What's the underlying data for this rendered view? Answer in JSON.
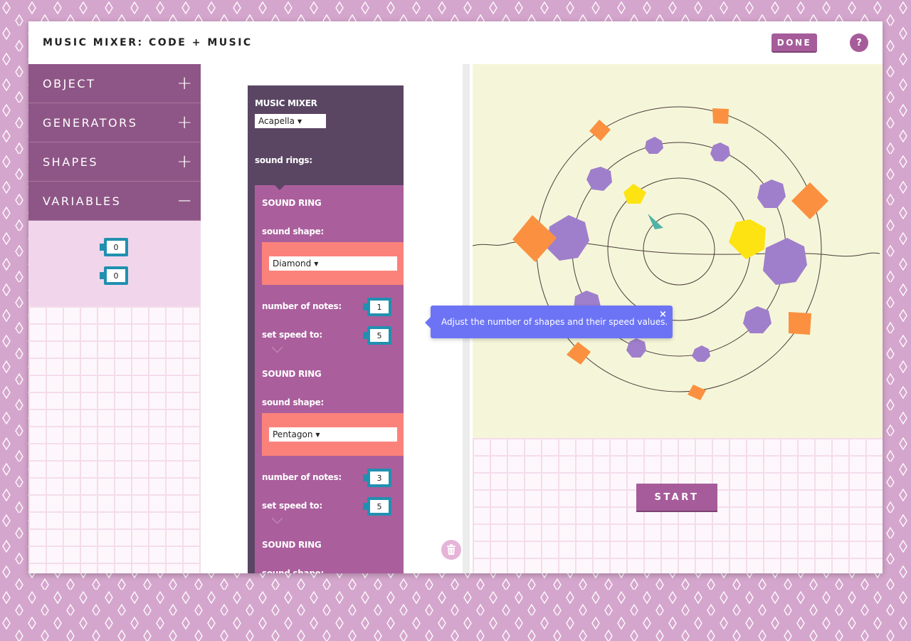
{
  "header": {
    "title": "MUSIC MIXER: CODE + MUSIC",
    "done_label": "DONE",
    "help_label": "?"
  },
  "sidebar": {
    "categories": [
      {
        "label": "OBJECT",
        "toggle": "+"
      },
      {
        "label": "GENERATORS",
        "toggle": "+"
      },
      {
        "label": "SHAPES",
        "toggle": "+"
      },
      {
        "label": "VARIABLES",
        "toggle": "−"
      }
    ],
    "variables": [
      "0",
      "0"
    ]
  },
  "workspace": {
    "block_title": "MUSIC MIXER",
    "sound_set": "Acapella",
    "rings_label": "sound rings:",
    "ring_title": "SOUND RING",
    "shape_label": "sound shape:",
    "notes_label": "number of notes:",
    "speed_label": "set speed to:",
    "rings": [
      {
        "shape": "Diamond",
        "notes": "1",
        "speed": "5"
      },
      {
        "shape": "Pentagon",
        "notes": "3",
        "speed": "5"
      },
      {
        "shape": "",
        "notes": "",
        "speed": ""
      }
    ]
  },
  "tooltip": {
    "text": "Adjust the number of shapes and their speed values.",
    "close": "×"
  },
  "stage": {
    "start_label": "START"
  },
  "colors": {
    "purple_dark": "#5a4663",
    "purple_block": "#aa5e9c",
    "salmon_block": "#fb827b",
    "teal": "#2190b0",
    "button": "#a65c9a",
    "tooltip": "#6c74f5",
    "stage_bg": "#f5f6d9",
    "shape_purple": "#9f7fcb",
    "shape_orange": "#fb9140",
    "shape_yellow": "#fde311"
  },
  "icons": {
    "trash": "trash-icon",
    "close": "close-icon",
    "caret": "caret-down-icon",
    "expand": "plus-icon",
    "collapse": "minus-icon"
  }
}
